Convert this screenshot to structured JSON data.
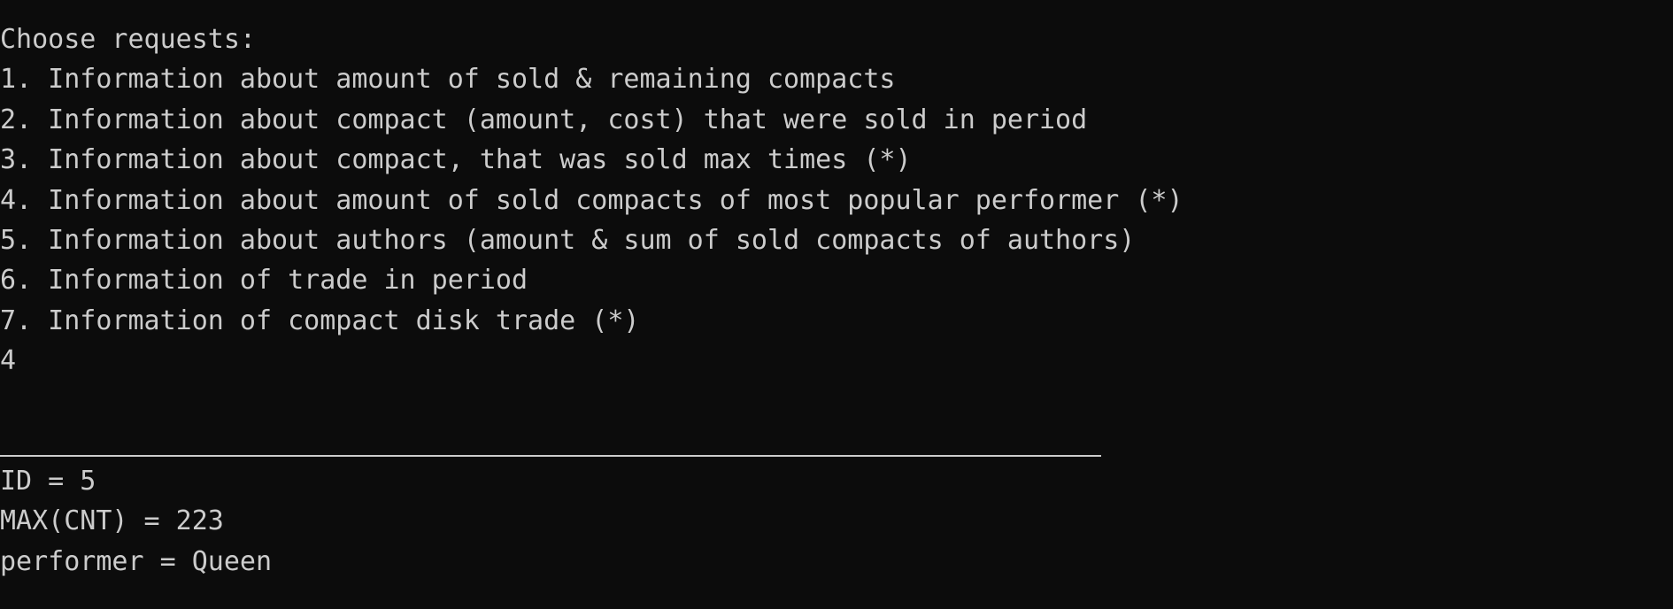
{
  "console": {
    "prompt": "Choose requests:",
    "menu_items": [
      "1. Information about amount of sold & remaining compacts",
      "2. Information about compact (amount, cost) that were sold in period",
      "3. Information about compact, that was sold max times (*)",
      "4. Information about amount of sold compacts of most popular performer (*)",
      "5. Information about authors (amount & sum of sold compacts of authors)",
      "6. Information of trade in period",
      "7. Information of compact disk trade (*)"
    ],
    "user_input": "4",
    "results": [
      "ID = 5",
      "MAX(CNT) = 223",
      "performer = Queen"
    ]
  },
  "colors": {
    "background": "#0c0c0c",
    "text": "#cccccc"
  }
}
